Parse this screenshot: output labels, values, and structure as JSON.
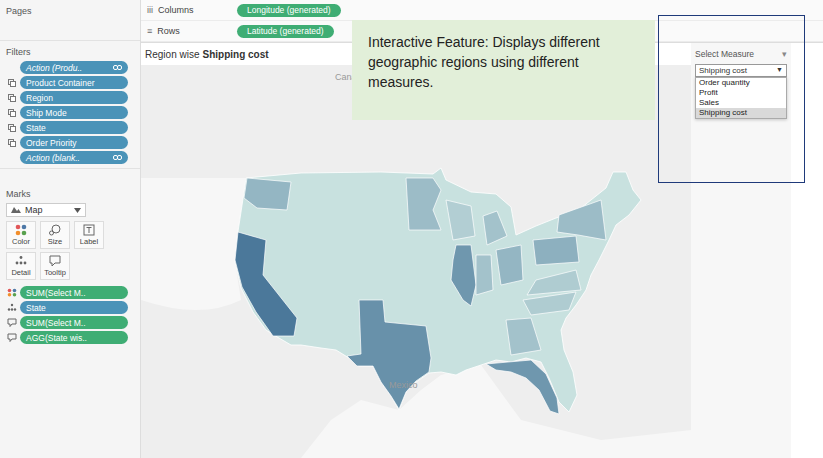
{
  "pages": {
    "title": "Pages"
  },
  "shelves": [
    {
      "icon": "iii",
      "label": "Columns",
      "pill": "Longitude (generated)"
    },
    {
      "icon": "≡",
      "label": "Rows",
      "pill": "Latitude (generated)"
    }
  ],
  "filters": {
    "title": "Filters",
    "items": [
      {
        "label": "Action (Produ..",
        "kind": "action"
      },
      {
        "label": "Product Container",
        "kind": "dimension"
      },
      {
        "label": "Region",
        "kind": "dimension"
      },
      {
        "label": "Ship Mode",
        "kind": "dimension"
      },
      {
        "label": "State",
        "kind": "dimension"
      },
      {
        "label": "Order Priority",
        "kind": "dimension"
      },
      {
        "label": "Action (blank..",
        "kind": "action"
      }
    ]
  },
  "marks": {
    "title": "Marks",
    "type": "Map",
    "buttons": [
      {
        "label": "Color",
        "kind": "color"
      },
      {
        "label": "Size",
        "kind": "size"
      },
      {
        "label": "Label",
        "kind": "label"
      },
      {
        "label": "Detail",
        "kind": "detail"
      },
      {
        "label": "Tooltip",
        "kind": "tooltip"
      }
    ],
    "fields": [
      {
        "label": "SUM(Select M..",
        "kind": "color",
        "role": "measure"
      },
      {
        "label": "State",
        "kind": "detail",
        "role": "dimension"
      },
      {
        "label": "SUM(Select M..",
        "kind": "tooltip",
        "role": "measure"
      },
      {
        "label": "AGG(State wis..",
        "kind": "tooltip",
        "role": "measure"
      }
    ]
  },
  "view": {
    "title_prefix": "Region wise",
    "title_measure": "Shipping cost",
    "map_labels": [
      {
        "text": "Cana"
      },
      {
        "text": "Mexico"
      }
    ]
  },
  "map": {
    "base_level": 0.05,
    "regions": [
      {
        "level": 0.9
      },
      {
        "level": 0.7
      },
      {
        "level": 0.65
      },
      {
        "level": 0.65
      },
      {
        "level": 0.4
      },
      {
        "level": 0.35
      },
      {
        "level": 0.2
      },
      {
        "level": 0.3
      },
      {
        "level": 0.3
      },
      {
        "level": 0.4
      },
      {
        "level": 0.45
      },
      {
        "level": 0.35
      },
      {
        "level": 0.3
      },
      {
        "level": 0.22
      },
      {
        "level": 0.22
      }
    ]
  },
  "annotation": "Interactive Feature: Displays different geographic regions using different measures.",
  "parameter": {
    "title": "Select Measure",
    "caret": "▾",
    "value": "Shipping cost",
    "arrow": "▼",
    "options": [
      {
        "label": "Order quantity",
        "selected": false
      },
      {
        "label": "Profit",
        "selected": false
      },
      {
        "label": "Sales",
        "selected": false
      },
      {
        "label": "Shipping cost",
        "selected": true
      }
    ]
  }
}
